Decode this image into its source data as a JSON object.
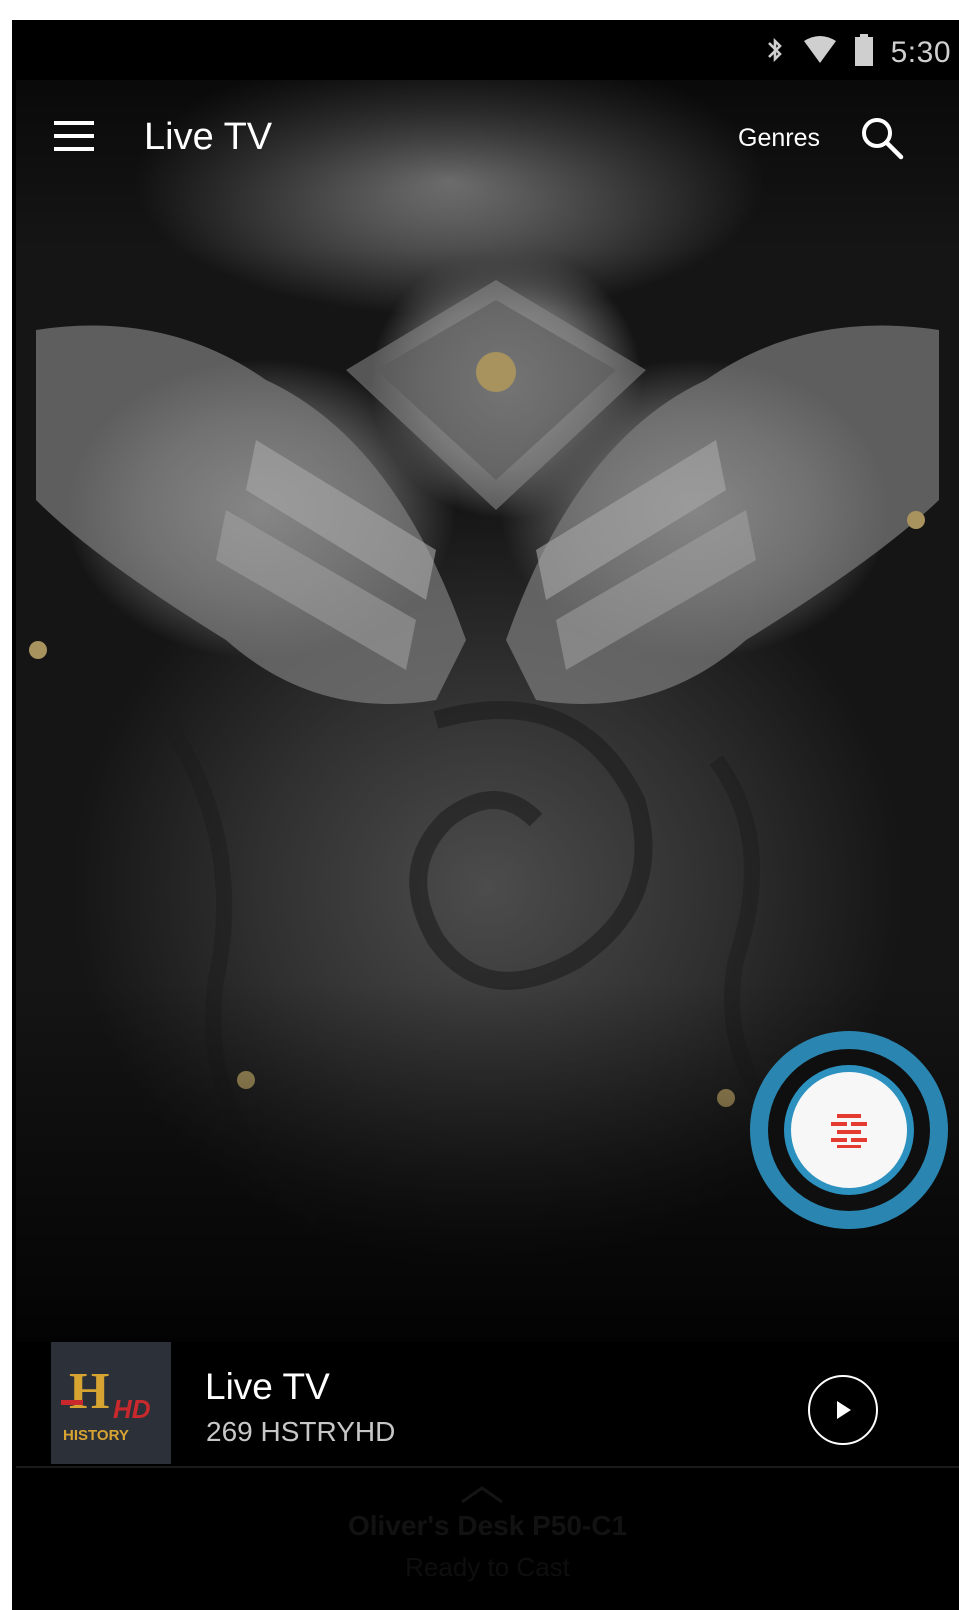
{
  "status_bar": {
    "time": "5:30",
    "icons": [
      "bluetooth-icon",
      "wifi-icon",
      "battery-icon"
    ]
  },
  "app_bar": {
    "title": "Live TV",
    "genres_label": "Genres",
    "icons": [
      "menu-icon",
      "search-icon"
    ]
  },
  "hero": {
    "description_icon": "armor-artwork"
  },
  "fab": {
    "icon": "guide-icon",
    "accent_color": "#2a86b0",
    "icon_color": "#e43a2f"
  },
  "now_playing": {
    "title": "Live TV",
    "subtitle": "269 HSTRYHD",
    "logo": {
      "letter": "H",
      "badge": "HD",
      "name": "HISTORY"
    },
    "play_icon": "play-icon"
  },
  "cast": {
    "device_name": "Oliver's Desk P50-C1",
    "status": "Ready to Cast",
    "chevron_icon": "chevron-up-icon"
  }
}
